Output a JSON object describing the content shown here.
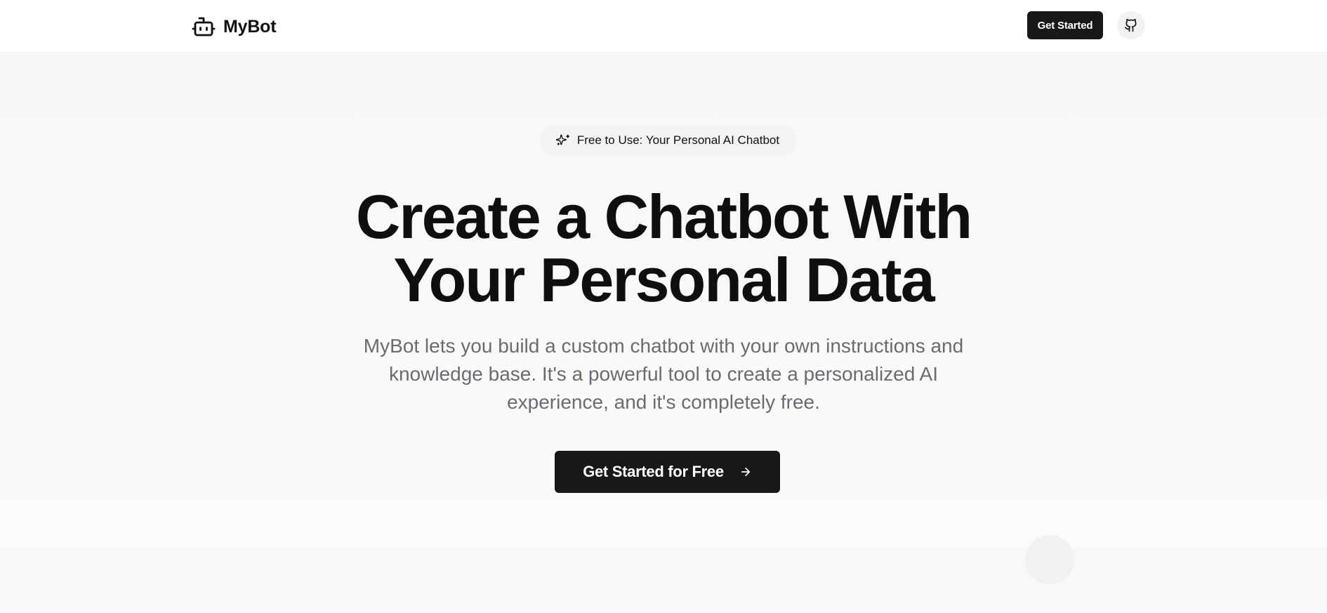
{
  "header": {
    "brand_name": "MyBot",
    "brand_icon": "robot-icon",
    "cta_label": "Get Started",
    "github_icon": "github-icon"
  },
  "hero": {
    "badge_icon": "sparkles-icon",
    "badge_text": "Free to Use: Your Personal AI Chatbot",
    "headline_lines": [
      "Create a Chatbot With",
      "Your Personal Data"
    ],
    "subtitle_lines": [
      "MyBot lets you build a custom chatbot with your own instructions and",
      "knowledge base. It's a powerful tool to create a personalized AI",
      "experience, and it's completely free."
    ],
    "cta_label": "Get Started for Free",
    "cta_icon": "arrow-right-icon"
  },
  "colors": {
    "primary": "#18181b",
    "text": "#0f0f0f",
    "muted_text": "#6b6b72",
    "background": "#f8f8f8"
  }
}
